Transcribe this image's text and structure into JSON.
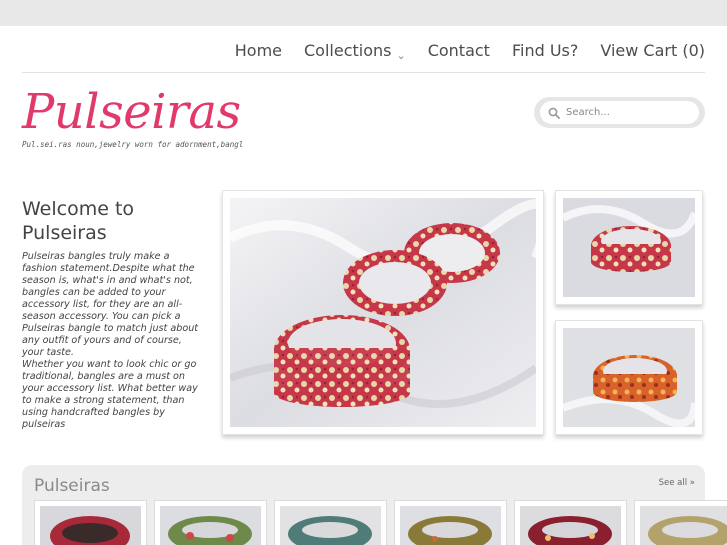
{
  "nav": {
    "items": [
      {
        "label": "Home"
      },
      {
        "label": "Collections",
        "has_dropdown": true
      },
      {
        "label": "Contact"
      },
      {
        "label": "Find Us?"
      },
      {
        "label": "View Cart (0)"
      }
    ]
  },
  "logo": {
    "title": "Pulseiras",
    "tagline": "Pul.sei.ras noun,jewelry worn for adornment,bangl"
  },
  "search": {
    "placeholder": "Search..."
  },
  "welcome": {
    "heading": "Welcome to Pulseiras",
    "body": "Pulseiras bangles truly make a fashion statement.Despite what the season is, what's in and what's not, bangles can be added to your accessory list, for they are an all-season accessory. You can pick a Pulseiras bangle to match just about any outfit of yours and of course, your taste.\nWhether you want to look chic or go traditional, bangles are a must on your accessory list. What better way to make a strong statement, than using handcrafted bangles by pulseiras"
  },
  "section": {
    "title": "Pulseiras",
    "see_all": "See all »"
  },
  "colors": {
    "brand_pink": "#e0396a",
    "nav_text": "#4d4d4d",
    "top_bar": "#e8e8e8",
    "section_bg": "#ededed"
  }
}
